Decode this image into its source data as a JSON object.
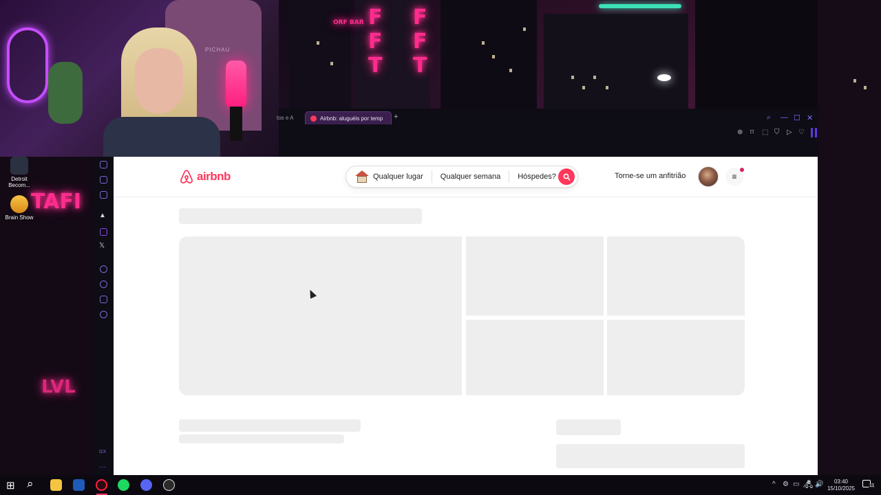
{
  "desktop": {
    "icons": [
      {
        "label": "Detroit Becom...",
        "icon": "game-icon"
      },
      {
        "label": "Brain Show",
        "icon": "brain-show-icon"
      }
    ],
    "neon_signs": [
      "TAFI",
      "ORF BAR"
    ]
  },
  "webcam": {
    "chair_label": "PICHAU"
  },
  "browser": {
    "tabs": [
      {
        "label": "tos e A",
        "active": false
      },
      {
        "label": "Airbnb: aluguéis por temp",
        "active": true
      }
    ],
    "new_tab": "+",
    "window_controls": [
      "search-icon",
      "minimize-icon",
      "maximize-icon",
      "close-icon"
    ],
    "toolbar_icons": [
      "zoom-icon",
      "bookmark-icon",
      "screenshot-icon",
      "shield-icon",
      "play-icon",
      "heart-icon"
    ]
  },
  "sidebar": {
    "icons": [
      "twitch-store-icon",
      "notes-icon",
      "m-icon",
      "aria-icon",
      "twitch-icon",
      "x-icon",
      "player-icon",
      "history-icon",
      "extensions-icon",
      "settings-icon",
      "gx-icon",
      "more-icon"
    ],
    "x_label": "𝕏",
    "gx_label": "GX",
    "more_label": "···"
  },
  "airbnb": {
    "logo_text": "airbnb",
    "brand_color": "#ff385c",
    "search": {
      "where": "Qualquer lugar",
      "when": "Qualquer semana",
      "who": "Hóspedes?"
    },
    "host_link": "Torne-se um anfitrião",
    "menu_icon": "≡"
  },
  "taskbar": {
    "apps": [
      "windows-start-icon",
      "search-icon",
      "file-explorer-icon",
      "a-app-icon",
      "opera-gx-icon",
      "spotify-icon",
      "discord-icon",
      "obs-icon"
    ],
    "start": "⊞",
    "search": "⌕",
    "tray": [
      "^",
      "⚙",
      "▭",
      "🎤",
      "🖧",
      "🔊"
    ],
    "time": "03:40",
    "date": "15/10/2025",
    "notification_count": "11"
  }
}
